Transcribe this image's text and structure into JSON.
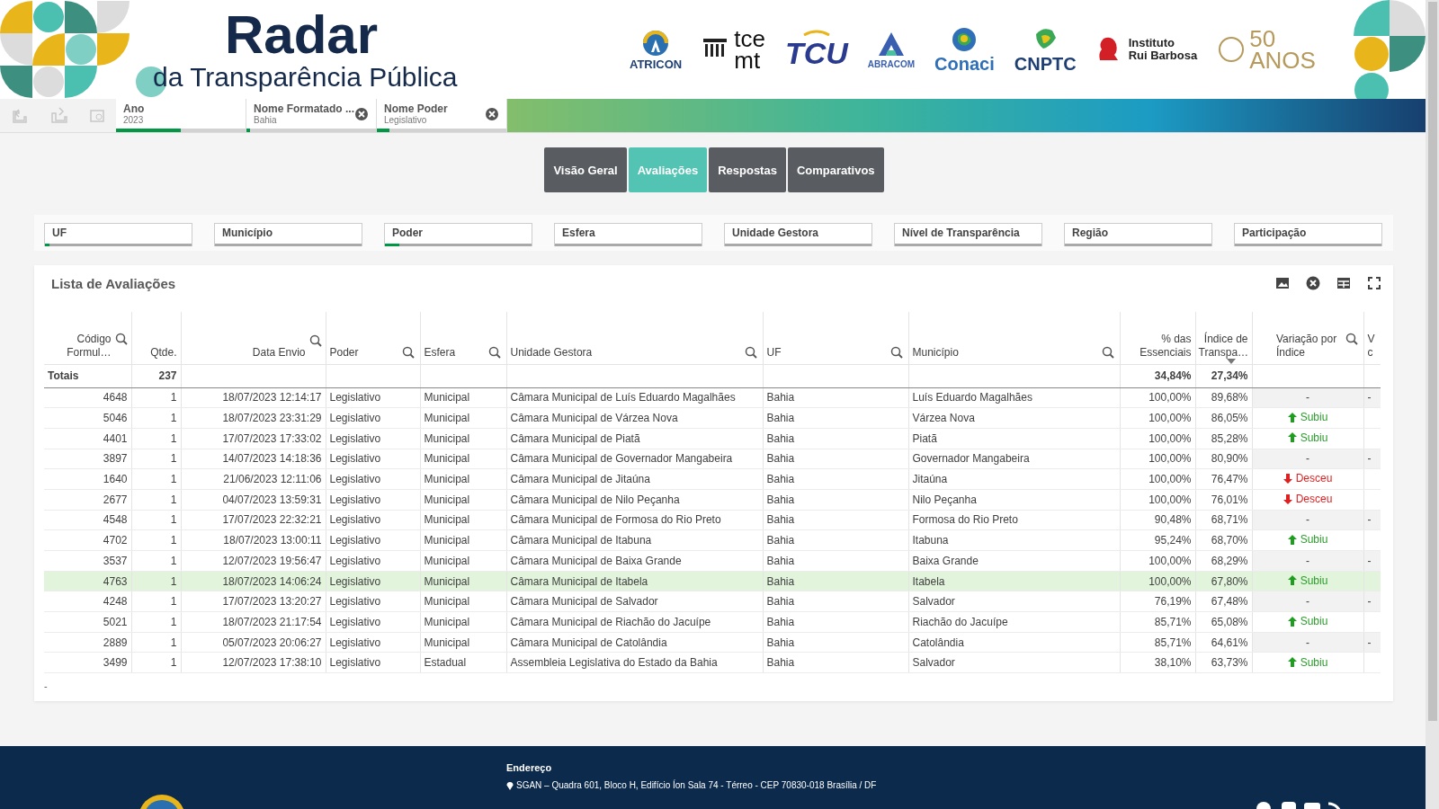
{
  "header": {
    "title": "Radar",
    "subtitle": "da Transparência Pública",
    "logos": [
      {
        "kind": "atricon",
        "lines": [
          "ATRICON"
        ]
      },
      {
        "kind": "tce",
        "lines": [
          "tce",
          "mt"
        ]
      },
      {
        "kind": "tcu",
        "lines": [
          "TCU"
        ]
      },
      {
        "kind": "abracom",
        "lines": [
          "ABRACOM"
        ]
      },
      {
        "kind": "conaci",
        "lines": [
          "Conaci"
        ]
      },
      {
        "kind": "cnptc",
        "lines": [
          "CNPTC"
        ]
      },
      {
        "kind": "irb",
        "lines": [
          "Instituto",
          "Rui Barbosa"
        ]
      },
      {
        "kind": "anos",
        "lines": [
          "50",
          "ANOS"
        ]
      }
    ]
  },
  "toolbar": [
    {
      "kind": "back"
    },
    {
      "kind": "forward"
    },
    {
      "kind": "clear"
    }
  ],
  "selections": [
    {
      "field": "Ano",
      "value": "2023",
      "clearable": false,
      "level": 0.5
    },
    {
      "field": "Nome Formatado ...",
      "value": "Bahia",
      "clearable": true,
      "level": 0.03
    },
    {
      "field": "Nome Poder",
      "value": "Legislativo",
      "clearable": true,
      "level": 0.1
    }
  ],
  "tabs": [
    {
      "label": "Visão Geral",
      "selected": false
    },
    {
      "label": "Avaliações",
      "selected": true
    },
    {
      "label": "Respostas",
      "selected": false
    },
    {
      "label": "Comparativos",
      "selected": false
    }
  ],
  "filters": [
    {
      "label": "UF",
      "level": 0.03
    },
    {
      "label": "Município"
    },
    {
      "label": "Poder",
      "level": 0.1
    },
    {
      "label": "Esfera"
    },
    {
      "label": "Unidade Gestora"
    },
    {
      "label": "Nível de Transparência"
    },
    {
      "label": "Região"
    },
    {
      "label": "Participação"
    }
  ],
  "table": {
    "title": "Lista de Avaliações",
    "columns": [
      {
        "label": "Código Formul…",
        "searchable": true,
        "sorted": false
      },
      {
        "label": "Qtde.",
        "searchable": false,
        "sorted": false
      },
      {
        "label": "Data Envio",
        "searchable": true,
        "sorted": false
      },
      {
        "label": "Poder",
        "searchable": true,
        "sorted": false
      },
      {
        "label": "Esfera",
        "searchable": true,
        "sorted": false
      },
      {
        "label": "Unidade Gestora",
        "searchable": true,
        "sorted": false
      },
      {
        "label": "UF",
        "searchable": true,
        "sorted": false
      },
      {
        "label": "Município",
        "searchable": true,
        "sorted": false
      },
      {
        "label": "% das Essenciais",
        "searchable": false,
        "sorted": false
      },
      {
        "label": "Índice de Transpa…",
        "searchable": false,
        "sorted": true
      },
      {
        "label": "Variação por Índice",
        "searchable": true,
        "sorted": false
      },
      {
        "label": "V c"
      }
    ],
    "totals": {
      "label": "Totais",
      "qtde": "237",
      "essenciais": "34,84%",
      "indice": "27,34%"
    },
    "rows": [
      {
        "cells": [
          "4648",
          "1",
          "18/07/2023 12:14:17",
          "Legislativo",
          "Municipal",
          "Câmara Municipal de Luís Eduardo Magalhães",
          "Bahia",
          "Luís Eduardo Magalhães",
          "100,00%",
          "89,68%"
        ],
        "variation": {
          "kind": "none",
          "text": "-"
        },
        "column_12": "-",
        "selected": false
      },
      {
        "cells": [
          "5046",
          "1",
          "18/07/2023 23:31:29",
          "Legislativo",
          "Municipal",
          "Câmara Municipal de Várzea Nova",
          "Bahia",
          "Várzea Nova",
          "100,00%",
          "86,05%"
        ],
        "variation": {
          "kind": "up",
          "text": "Subiu"
        },
        "selected": false
      },
      {
        "cells": [
          "4401",
          "1",
          "17/07/2023 17:33:02",
          "Legislativo",
          "Municipal",
          "Câmara Municipal de Piatã",
          "Bahia",
          "Piatã",
          "100,00%",
          "85,28%"
        ],
        "variation": {
          "kind": "up",
          "text": "Subiu"
        },
        "selected": false
      },
      {
        "cells": [
          "3897",
          "1",
          "14/07/2023 14:18:36",
          "Legislativo",
          "Municipal",
          "Câmara Municipal de Governador Mangabeira",
          "Bahia",
          "Governador Mangabeira",
          "100,00%",
          "80,90%"
        ],
        "variation": {
          "kind": "none",
          "text": "-"
        },
        "column_12": "-",
        "selected": false
      },
      {
        "cells": [
          "1640",
          "1",
          "21/06/2023 12:11:06",
          "Legislativo",
          "Municipal",
          "Câmara Municipal de Jitaúna",
          "Bahia",
          "Jitaúna",
          "100,00%",
          "76,47%"
        ],
        "variation": {
          "kind": "down",
          "text": "Desceu"
        },
        "selected": false
      },
      {
        "cells": [
          "2677",
          "1",
          "04/07/2023 13:59:31",
          "Legislativo",
          "Municipal",
          "Câmara Municipal de Nilo Peçanha",
          "Bahia",
          "Nilo Peçanha",
          "100,00%",
          "76,01%"
        ],
        "variation": {
          "kind": "down",
          "text": "Desceu"
        },
        "selected": false
      },
      {
        "cells": [
          "4548",
          "1",
          "17/07/2023 22:32:21",
          "Legislativo",
          "Municipal",
          "Câmara Municipal de Formosa do Rio Preto",
          "Bahia",
          "Formosa do Rio Preto",
          "90,48%",
          "68,71%"
        ],
        "variation": {
          "kind": "none",
          "text": "-"
        },
        "column_12": "-",
        "selected": false
      },
      {
        "cells": [
          "4702",
          "1",
          "18/07/2023 13:00:11",
          "Legislativo",
          "Municipal",
          "Câmara Municipal de Itabuna",
          "Bahia",
          "Itabuna",
          "95,24%",
          "68,70%"
        ],
        "variation": {
          "kind": "up",
          "text": "Subiu"
        },
        "selected": false
      },
      {
        "cells": [
          "3537",
          "1",
          "12/07/2023 19:56:47",
          "Legislativo",
          "Municipal",
          "Câmara Municipal de Baixa Grande",
          "Bahia",
          "Baixa Grande",
          "100,00%",
          "68,29%"
        ],
        "variation": {
          "kind": "none",
          "text": "-"
        },
        "column_12": "-",
        "selected": false
      },
      {
        "cells": [
          "4763",
          "1",
          "18/07/2023 14:06:24",
          "Legislativo",
          "Municipal",
          "Câmara Municipal de Itabela",
          "Bahia",
          "Itabela",
          "100,00%",
          "67,80%"
        ],
        "variation": {
          "kind": "up",
          "text": "Subiu"
        },
        "selected": true
      },
      {
        "cells": [
          "4248",
          "1",
          "17/07/2023 13:20:27",
          "Legislativo",
          "Municipal",
          "Câmara Municipal de Salvador",
          "Bahia",
          "Salvador",
          "76,19%",
          "67,48%"
        ],
        "variation": {
          "kind": "none",
          "text": "-"
        },
        "column_12": "-",
        "selected": false
      },
      {
        "cells": [
          "5021",
          "1",
          "18/07/2023 21:17:54",
          "Legislativo",
          "Municipal",
          "Câmara Municipal de Riachão do Jacuípe",
          "Bahia",
          "Riachão do Jacuípe",
          "85,71%",
          "65,08%"
        ],
        "variation": {
          "kind": "up",
          "text": "Subiu"
        },
        "selected": false
      },
      {
        "cells": [
          "2889",
          "1",
          "05/07/2023 20:06:27",
          "Legislativo",
          "Municipal",
          "Câmara Municipal de Catolândia",
          "Bahia",
          "Catolândia",
          "85,71%",
          "64,61%"
        ],
        "variation": {
          "kind": "none",
          "text": "-"
        },
        "column_12": "-",
        "selected": false
      },
      {
        "cells": [
          "3499",
          "1",
          "12/07/2023 17:38:10",
          "Legislativo",
          "Estadual",
          "Assembleia Legislativa do Estado da Bahia",
          "Bahia",
          "Salvador",
          "38,10%",
          "63,73%"
        ],
        "variation": {
          "kind": "up",
          "text": "Subiu"
        },
        "selected": false
      }
    ],
    "footnote": "-"
  },
  "footer": {
    "heading": "Endereço",
    "address": "SGAN – Quadra 601, Bloco H, Edifício Íon Sala 74 - Térreo - CEP 70830-018 Brasília / DF"
  }
}
